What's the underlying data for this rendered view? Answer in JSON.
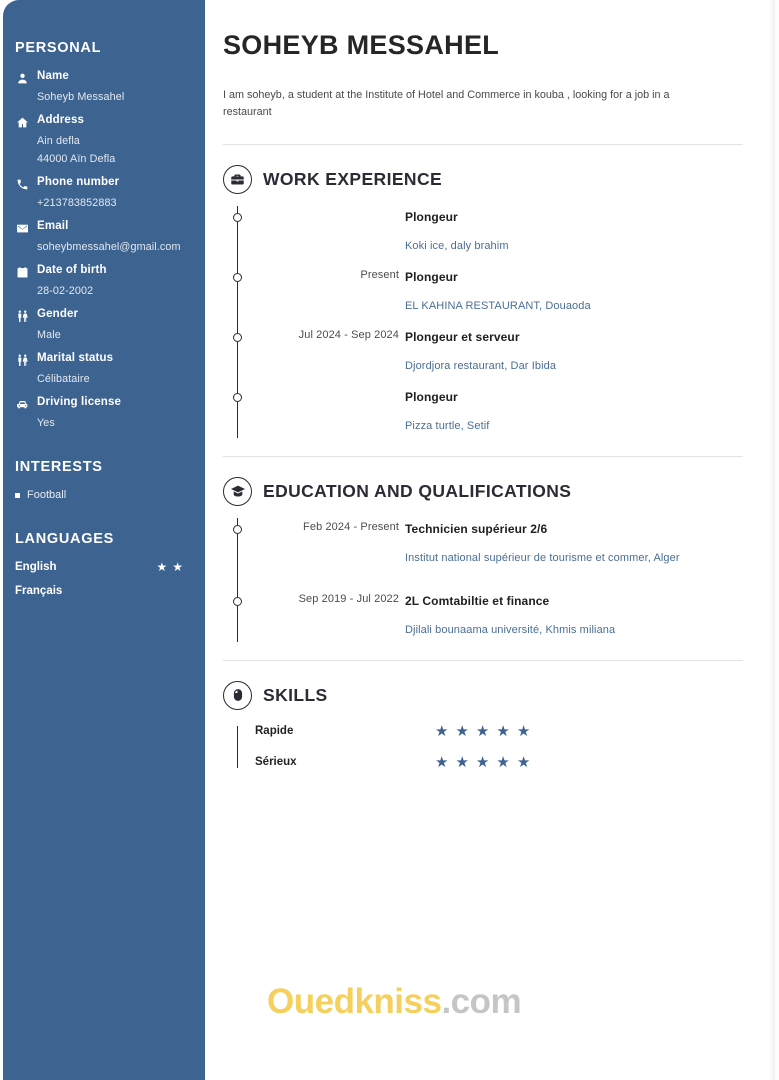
{
  "sidebar": {
    "personal": {
      "heading": "PERSONAL",
      "fields": [
        {
          "icon": "person-icon",
          "label": "Name",
          "value": "Soheyb Messahel"
        },
        {
          "icon": "home-icon",
          "label": "Address",
          "value": "Ain defla",
          "value2": "44000 Aïn Defla"
        },
        {
          "icon": "phone-icon",
          "label": "Phone number",
          "value": "+213783852883"
        },
        {
          "icon": "envelope-icon",
          "label": "Email",
          "value": "soheybmessahel@gmail.com"
        },
        {
          "icon": "calendar-icon",
          "label": "Date of birth",
          "value": "28-02-2002"
        },
        {
          "icon": "gender-icon",
          "label": "Gender",
          "value": "Male"
        },
        {
          "icon": "marital-status-icon",
          "label": "Marital status",
          "value": "Célibataire"
        },
        {
          "icon": "car-icon",
          "label": "Driving license",
          "value": "Yes"
        }
      ]
    },
    "interests": {
      "heading": "INTERESTS",
      "items": [
        {
          "label": "Football"
        }
      ]
    },
    "languages": {
      "heading": "LANGUAGES",
      "items": [
        {
          "name": "English",
          "stars": 2
        },
        {
          "name": "Français",
          "stars": 0
        }
      ]
    }
  },
  "main": {
    "name": "SOHEYB MESSAHEL",
    "summary": "I am soheyb, a student at the Institute of Hotel and Commerce in kouba , looking for a job in a restaurant",
    "work": {
      "title": "WORK EXPERIENCE",
      "icon": "briefcase-icon",
      "items": [
        {
          "date": "",
          "role": "Plongeur",
          "place": "Koki ice, daly brahim"
        },
        {
          "date": "Present",
          "role": "Plongeur",
          "place": "EL KAHINA RESTAURANT, Douaoda"
        },
        {
          "date": "Jul 2024 - Sep 2024",
          "role": "Plongeur et serveur",
          "place": "Djordjora restaurant, Dar Ibida"
        },
        {
          "date": "",
          "role": "Plongeur",
          "place": "Pizza turtle, Setif"
        }
      ]
    },
    "education": {
      "title": "EDUCATION AND QUALIFICATIONS",
      "icon": "graduation-cap-icon",
      "items": [
        {
          "date": "Feb 2024 - Present",
          "degree": "Technicien supérieur 2/6",
          "school": "Institut national supérieur de tourisme et commer, Alger"
        },
        {
          "date": "Sep 2019 - Jul 2022",
          "degree": "2L Comtabiltie et finance",
          "school": "Djilali bounaama université, Khmis miliana"
        }
      ]
    },
    "skills": {
      "title": "SKILLS",
      "icon": "mouse-icon",
      "items": [
        {
          "name": "Rapide",
          "stars": 5
        },
        {
          "name": "Sérieux",
          "stars": 5
        }
      ]
    }
  },
  "watermark": {
    "brand": "Ouedkniss",
    "tld": ".com"
  },
  "colors": {
    "sidebar_bg": "#3d6390",
    "star_blue": "#3f6391",
    "link_blue": "#4b6e96",
    "heading_dark": "#2b2b35",
    "watermark_gold": "#f3c435"
  }
}
